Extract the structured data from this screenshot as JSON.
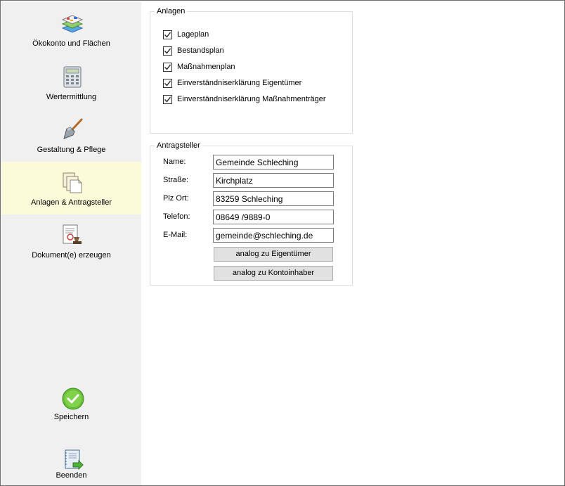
{
  "sidebar": {
    "items": [
      {
        "label": "Ökokonto und Flächen",
        "icon": "layers-map-icon"
      },
      {
        "label": "Wertermittlung",
        "icon": "calculator-icon"
      },
      {
        "label": "Gestaltung & Pflege",
        "icon": "shovel-icon"
      },
      {
        "label": "Anlagen & Antragsteller",
        "icon": "documents-icon",
        "active": true
      },
      {
        "label": "Dokument(e) erzeugen",
        "icon": "certificate-stamp-icon"
      }
    ],
    "save_label": "Speichern",
    "exit_label": "Beenden"
  },
  "anlagen": {
    "title": "Anlagen",
    "items": [
      {
        "label": "Lageplan",
        "checked": true
      },
      {
        "label": "Bestandsplan",
        "checked": true
      },
      {
        "label": "Maßnahmenplan",
        "checked": true
      },
      {
        "label": "Einverständniserklärung Eigentümer",
        "checked": true
      },
      {
        "label": "Einverständniserklärung Maßnahmenträger",
        "checked": true
      }
    ]
  },
  "antragsteller": {
    "title": "Antragsteller",
    "name_label": "Name:",
    "name_value": "Gemeinde Schleching",
    "strasse_label": "Straße:",
    "strasse_value": "Kirchplatz",
    "plzort_label": "Plz Ort:",
    "plzort_value": "83259 Schleching",
    "telefon_label": "Telefon:",
    "telefon_value": "08649 /9889-0",
    "email_label": "E-Mail:",
    "email_value": "gemeinde@schleching.de",
    "btn_eigentuemer": "analog zu Eigentümer",
    "btn_kontoinhaber": "analog zu Kontoinhaber"
  },
  "colors": {
    "sidebar_bg": "#f0f0f0",
    "active_bg": "#fbfbd9",
    "button_bg": "#e1e1e1"
  }
}
